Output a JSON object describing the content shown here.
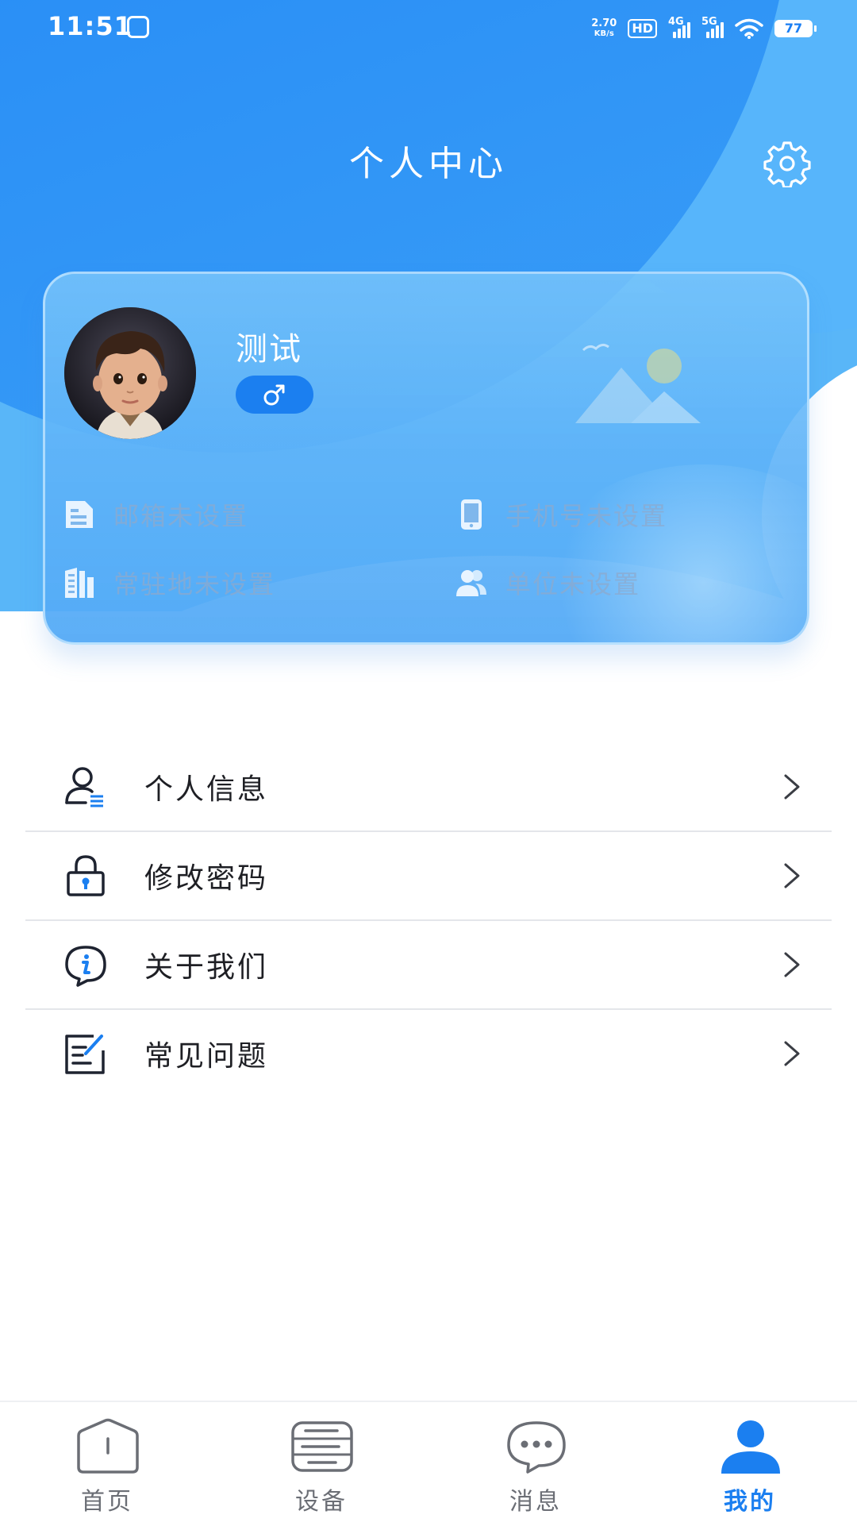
{
  "status_bar": {
    "time": "11:51",
    "net_speed_value": "2.70",
    "net_speed_unit": "KB/s",
    "hd_badge": "HD",
    "sim1_network": "4G",
    "sim2_network": "5G",
    "battery": "77"
  },
  "header": {
    "title": "个人中心",
    "settings_icon": "gear-icon"
  },
  "profile": {
    "name": "测试",
    "gender_icon": "male-icon",
    "info": [
      {
        "icon": "email-icon",
        "text": "邮箱未设置"
      },
      {
        "icon": "phone-icon",
        "text": "手机号未设置"
      },
      {
        "icon": "address-book-icon",
        "text": "常驻地未设置"
      },
      {
        "icon": "users-icon",
        "text": "单位未设置"
      }
    ]
  },
  "menu": [
    {
      "icon": "user-info-icon",
      "label": "个人信息"
    },
    {
      "icon": "lock-icon",
      "label": "修改密码"
    },
    {
      "icon": "info-bubble-icon",
      "label": "关于我们"
    },
    {
      "icon": "faq-edit-icon",
      "label": "常见问题"
    }
  ],
  "bottom_nav": {
    "active_index": 3,
    "active_color": "#1b7ff0",
    "items": [
      {
        "icon": "home-icon",
        "label": "首页"
      },
      {
        "icon": "device-icon",
        "label": "设备"
      },
      {
        "icon": "message-icon",
        "label": "消息"
      },
      {
        "icon": "person-icon",
        "label": "我的"
      }
    ]
  },
  "colors": {
    "primary": "#1b7ff0",
    "header_blue": "#2b90f6",
    "light_blue": "#59b6f8"
  }
}
